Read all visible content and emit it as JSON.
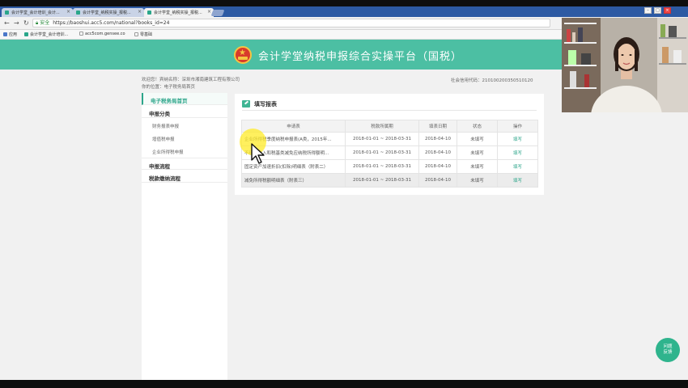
{
  "browser": {
    "tabs": [
      {
        "label": "会计学堂_会计培训_会计..."
      },
      {
        "label": "会计学堂_纳税实操_报税..."
      },
      {
        "label": "会计学堂_纳税实操_报税..."
      }
    ],
    "address": {
      "secure_label": "安全",
      "url": "https://baoshui.acc5.com/national?books_id=24"
    },
    "bookmarks": [
      {
        "label": "应用"
      },
      {
        "label": "会计学堂_会计培训..."
      },
      {
        "label": "acc5com.gensee.co"
      },
      {
        "label": "零基础"
      }
    ]
  },
  "header": {
    "title": "会计学堂纳税申报综合实操平台（国税）"
  },
  "info": {
    "welcome": "欢迎您！宾纳名称：深圳市湘南建筑工程有限公司",
    "location": "你的位置：电子税务局首页",
    "tax_code": "社会信用代码：210100200350510120"
  },
  "sidebar": {
    "items": [
      {
        "label": "电子税务局首页"
      },
      {
        "label": "申报分类"
      },
      {
        "label": "财务报表申报"
      },
      {
        "label": "增值税申报"
      },
      {
        "label": "企业所得税申报"
      },
      {
        "label": "申报流程"
      },
      {
        "label": "税款缴纳流程"
      }
    ]
  },
  "panel": {
    "title": "填写报表",
    "columns": [
      "申请表",
      "税款所属期",
      "填表日期",
      "状态",
      "操作"
    ],
    "rows": [
      {
        "name": "企业所得税季度纳税申报表(A类，2015年...",
        "period": "2018-01-01 ~ 2018-03-31",
        "date": "2018-04-10",
        "status": "未填写",
        "op": "填写"
      },
      {
        "name": "不征税收入和税基类减免应纳税所得额明...",
        "period": "2018-01-01 ~ 2018-03-31",
        "date": "2018-04-10",
        "status": "未填写",
        "op": "填写"
      },
      {
        "name": "固定资产加速折旧(扣除)明细表（附表二）",
        "period": "2018-01-01 ~ 2018-03-31",
        "date": "2018-04-10",
        "status": "未填写",
        "op": "填写"
      },
      {
        "name": "减免所得税额明细表（附表三）",
        "period": "2018-01-01 ~ 2018-03-31",
        "date": "2018-04-10",
        "status": "未填写",
        "op": "填写"
      }
    ]
  },
  "feedback": {
    "line1": "问题",
    "line2": "反馈"
  }
}
